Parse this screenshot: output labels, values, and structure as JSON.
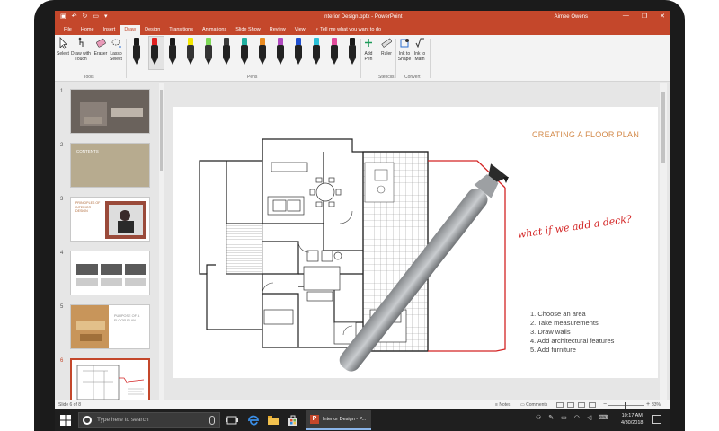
{
  "app": {
    "title": "Interior Design.pptx  -  PowerPoint",
    "user": "Aimee Owens",
    "window_controls": [
      "—",
      "❐",
      "✕"
    ]
  },
  "quick_access": {
    "save_icon": "save-icon",
    "undo_icon": "undo-icon",
    "redo_icon": "redo-icon",
    "present_icon": "present-icon"
  },
  "tabs": [
    "File",
    "Home",
    "Insert",
    "Draw",
    "Design",
    "Transitions",
    "Animations",
    "Slide Show",
    "Review",
    "View"
  ],
  "active_tab": "Draw",
  "tell_me": "Tell me what you want to do",
  "ribbon": {
    "tools": {
      "select": "Select",
      "draw_with_touch": "Draw with Touch",
      "eraser": "Eraser",
      "lasso_select": "Lasso Select",
      "group": "Tools"
    },
    "pens": {
      "group": "Pens",
      "items": [
        {
          "color": "#1a1a1a",
          "type": "pen"
        },
        {
          "color": "#e02020",
          "type": "pen",
          "selected": true
        },
        {
          "color": "#1a1a1a",
          "type": "pen"
        },
        {
          "color": "#f2e600",
          "type": "highlighter"
        },
        {
          "color": "#7ed957",
          "type": "highlighter"
        },
        {
          "color": "#3a3a3a",
          "type": "pen"
        },
        {
          "color": "#20b0a0",
          "type": "pen"
        },
        {
          "color": "#e98b22",
          "type": "pen"
        },
        {
          "color": "#b04ac0",
          "type": "pen"
        },
        {
          "color": "#1f4fd0",
          "type": "pen"
        },
        {
          "color": "#2ac0d8",
          "type": "pen"
        },
        {
          "color": "#e14b9b",
          "type": "pen"
        },
        {
          "color": "#1a1a1a",
          "type": "pen"
        }
      ]
    },
    "add_pen": "Add Pen",
    "ruler": "Ruler",
    "ink_to_shape": "Ink to Shape",
    "ink_to_math": "Ink to Math",
    "stencils_group": "Stencils",
    "convert_group": "Convert"
  },
  "thumbnails": [
    {
      "number": "1"
    },
    {
      "number": "2",
      "caption": "CONTENTS"
    },
    {
      "number": "3",
      "caption": "PRINCIPLES OF INTERIOR DESIGN"
    },
    {
      "number": "4"
    },
    {
      "number": "5",
      "caption": "PURPOSE OF A FLOOR PLAN"
    },
    {
      "number": "6",
      "selected": true
    }
  ],
  "slide": {
    "title": "CREATING A FLOOR PLAN",
    "ink_note": "what if we add a deck?",
    "steps": [
      "1. Choose an area",
      "2. Take measurements",
      "3. Draw walls",
      "4. Add architectural features",
      "5. Add furniture"
    ]
  },
  "status": {
    "slide_count": "Slide 6 of 8",
    "notes": "Notes",
    "comments": "Comments",
    "zoom": "83%",
    "zoom_minus": "−",
    "zoom_plus": "+"
  },
  "taskbar": {
    "search_placeholder": "Type here to search",
    "ppt_task": "Interior Design - P...",
    "ppt_letter": "P",
    "time": "10:17 AM",
    "date": "4/30/2018",
    "tray_icons": [
      "people-icon",
      "pen-icon",
      "battery-icon",
      "wifi-icon",
      "volume-icon",
      "keyboard-icon"
    ]
  },
  "colors": {
    "accent": "#c4472b",
    "ink_red": "#d32424",
    "slide_title": "#d38a4a"
  }
}
